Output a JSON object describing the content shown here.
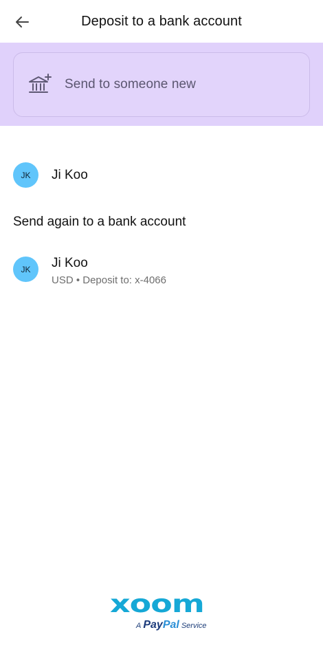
{
  "header": {
    "title": "Deposit to a bank account",
    "back_icon": "arrow-left-icon"
  },
  "new_recipient": {
    "label": "Send to someone new",
    "icon": "bank-plus-icon",
    "band_color": "#e0d1fb"
  },
  "recent": [
    {
      "initials": "JK",
      "name": "Ji Koo"
    }
  ],
  "send_again": {
    "heading": "Send again to a bank account",
    "items": [
      {
        "initials": "JK",
        "name": "Ji Koo",
        "details": "USD • Deposit to: x-4066"
      }
    ]
  },
  "logo": {
    "wordmark": "xoom",
    "tag_prefix": "A",
    "tag_brand_1": "Pay",
    "tag_brand_2": "Pal",
    "tag_suffix": "Service"
  },
  "colors": {
    "avatar": "#60c5fb",
    "accent_purple": "#e0d1fb",
    "xoom_blue": "#16a8d6"
  }
}
